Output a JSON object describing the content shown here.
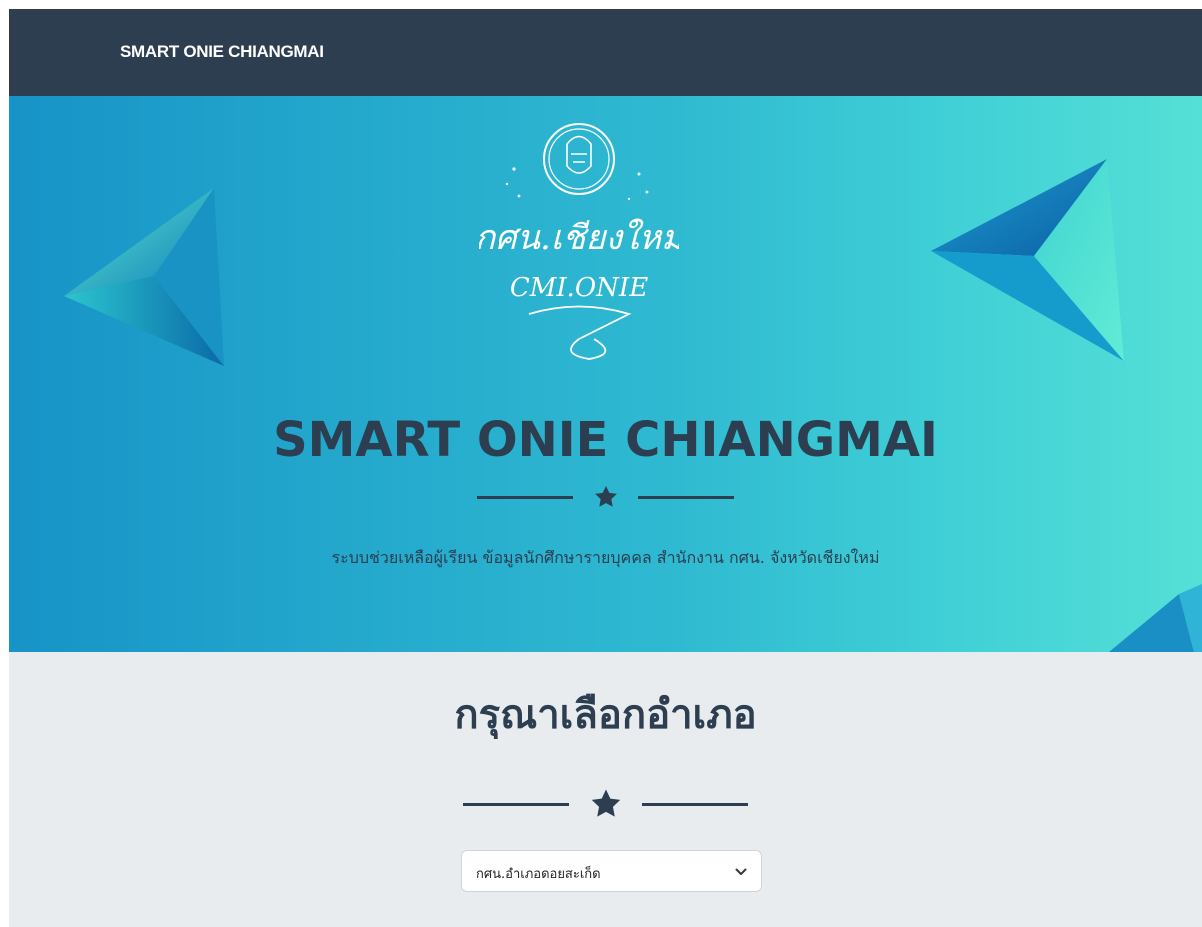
{
  "navbar": {
    "brand": "SMART ONIE CHIANGMAI"
  },
  "hero": {
    "logo_text_thai": "กศน.เชียงใหม่",
    "logo_text_latin": "CMI.ONIE",
    "title": "SMART ONIE CHIANGMAI",
    "subtitle": "ระบบช่วยเหลือผู้เรียน ข้อมูลนักศึกษารายบุคคล สำนักงาน กศน. จังหวัดเชียงใหม่",
    "divider_icon": "star-icon"
  },
  "district": {
    "heading": "กรุณาเลือกอำเภอ",
    "divider_icon": "star-icon",
    "selected_value": "กศน.อำเภอดอยสะเก็ด",
    "chevron_icon": "chevron-down-icon"
  },
  "colors": {
    "navbar_bg": "#2c3e50",
    "text_dark": "#2c3e50",
    "hero_gradient_start": "#1793c7",
    "hero_gradient_end": "#55e0d6",
    "lower_bg": "#e9ecef"
  }
}
